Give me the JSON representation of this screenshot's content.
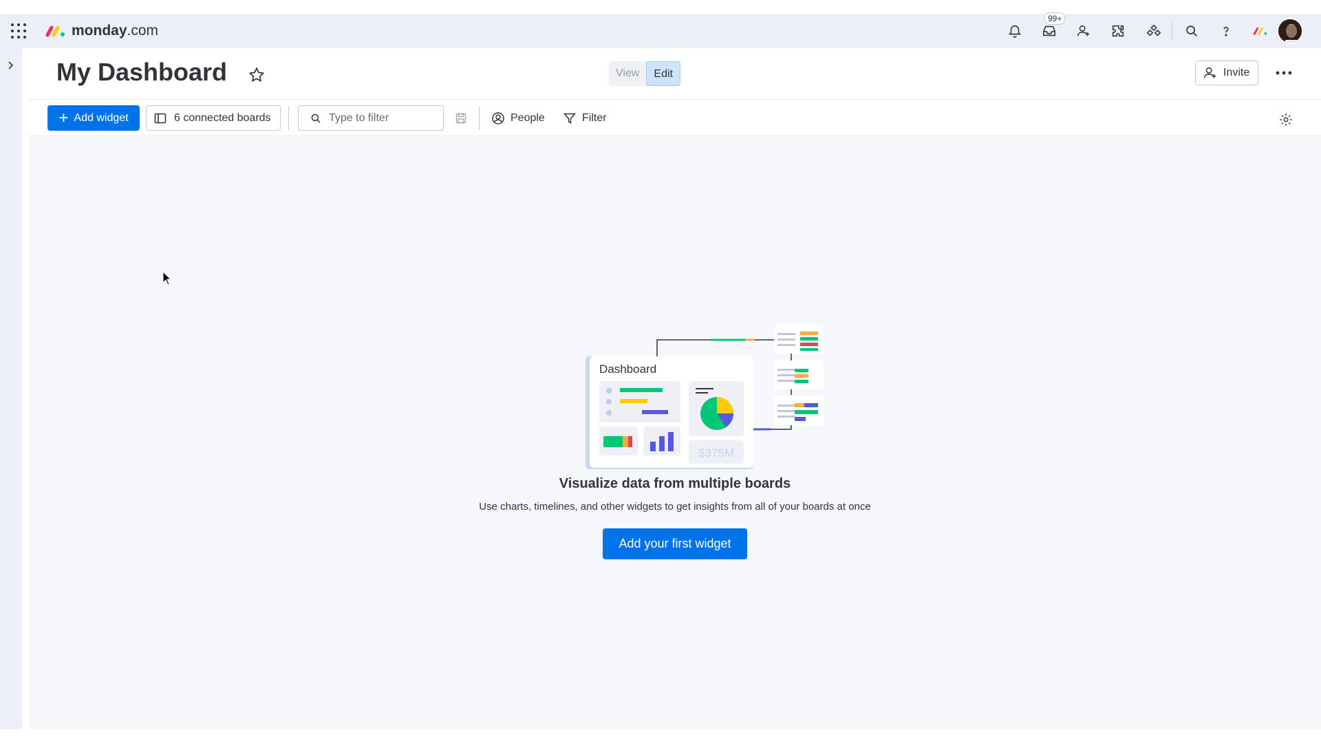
{
  "app": {
    "brand_bold": "monday",
    "brand_suffix": ".com",
    "notification_count": "99+"
  },
  "header": {
    "title": "My Dashboard",
    "view_label": "View",
    "edit_label": "Edit",
    "invite_label": "Invite"
  },
  "toolbar": {
    "add_widget_label": "Add widget",
    "connected_boards_label": "6 connected boards",
    "search_placeholder": "Type to filter",
    "people_label": "People",
    "filter_label": "Filter"
  },
  "empty_state": {
    "illustration_title": "Dashboard",
    "illustration_value": "$375M",
    "title": "Visualize data from multiple boards",
    "subtitle": "Use charts, timelines, and other widgets to get insights from all of your boards at once",
    "cta_label": "Add your first widget"
  },
  "colors": {
    "primary": "#0073ea",
    "topbar": "#eceff8",
    "canvas": "#f6f7fb",
    "green": "#00c875",
    "yellow": "#fdab3d",
    "purple": "#5559df",
    "red": "#e2445c"
  },
  "icons": [
    "apps-grid-icon",
    "monday-logo-icon",
    "bell-icon",
    "inbox-icon",
    "invite-member-icon",
    "apps-puzzle-icon",
    "marketplace-icon",
    "search-icon",
    "help-icon",
    "avatar",
    "chevron-right-icon",
    "star-icon",
    "more-icon",
    "plus-icon",
    "board-icon",
    "save-icon",
    "person-icon",
    "filter-icon",
    "gear-icon"
  ]
}
